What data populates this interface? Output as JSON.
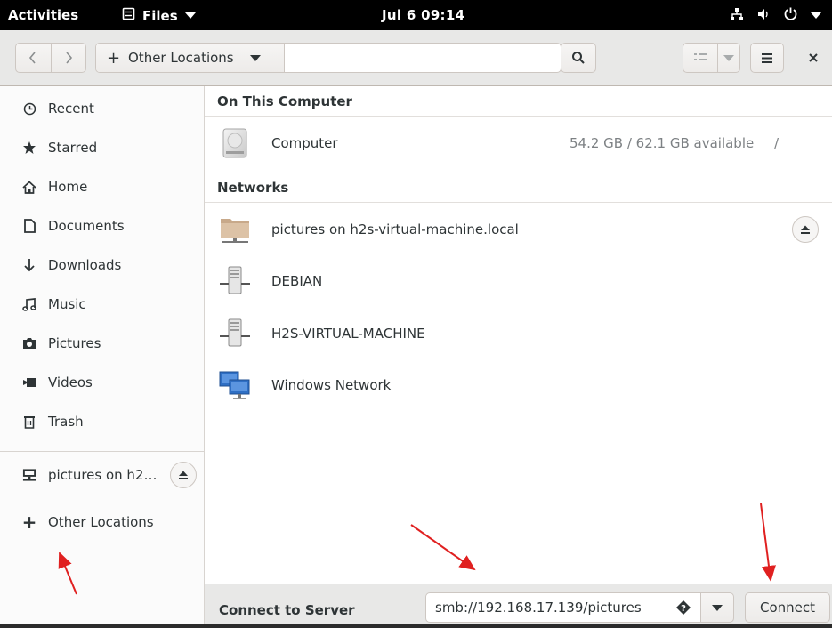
{
  "topbar": {
    "activities": "Activities",
    "app_name": "Files",
    "clock": "Jul 6  09:14"
  },
  "headerbar": {
    "path_label": "Other Locations"
  },
  "sidebar": {
    "items": [
      {
        "label": "Recent",
        "icon": "clock-icon"
      },
      {
        "label": "Starred",
        "icon": "star-icon"
      },
      {
        "label": "Home",
        "icon": "home-icon"
      },
      {
        "label": "Documents",
        "icon": "document-icon"
      },
      {
        "label": "Downloads",
        "icon": "download-icon"
      },
      {
        "label": "Music",
        "icon": "music-icon"
      },
      {
        "label": "Pictures",
        "icon": "camera-icon"
      },
      {
        "label": "Videos",
        "icon": "video-icon"
      },
      {
        "label": "Trash",
        "icon": "trash-icon"
      }
    ],
    "mount": {
      "label": "pictures on h2…",
      "icon": "network-share-icon"
    },
    "other_locations": "Other Locations"
  },
  "main": {
    "on_this_computer": "On This Computer",
    "computer": {
      "label": "Computer",
      "info": "54.2 GB / 62.1 GB available",
      "path": "/"
    },
    "networks": "Networks",
    "network_items": [
      {
        "label": "pictures on h2s-virtual-machine.local",
        "icon": "folder-share-icon"
      },
      {
        "label": "DEBIAN",
        "icon": "server-icon"
      },
      {
        "label": "H2S-VIRTUAL-MACHINE",
        "icon": "server-icon"
      },
      {
        "label": "Windows Network",
        "icon": "windows-network-icon"
      }
    ]
  },
  "connect": {
    "label": "Connect to Server",
    "address": "smb://192.168.17.139/pictures",
    "button": "Connect"
  },
  "colors": {
    "arrow": "#e02020",
    "topbar": "#000000",
    "headerbar": "#e8e8e7"
  }
}
